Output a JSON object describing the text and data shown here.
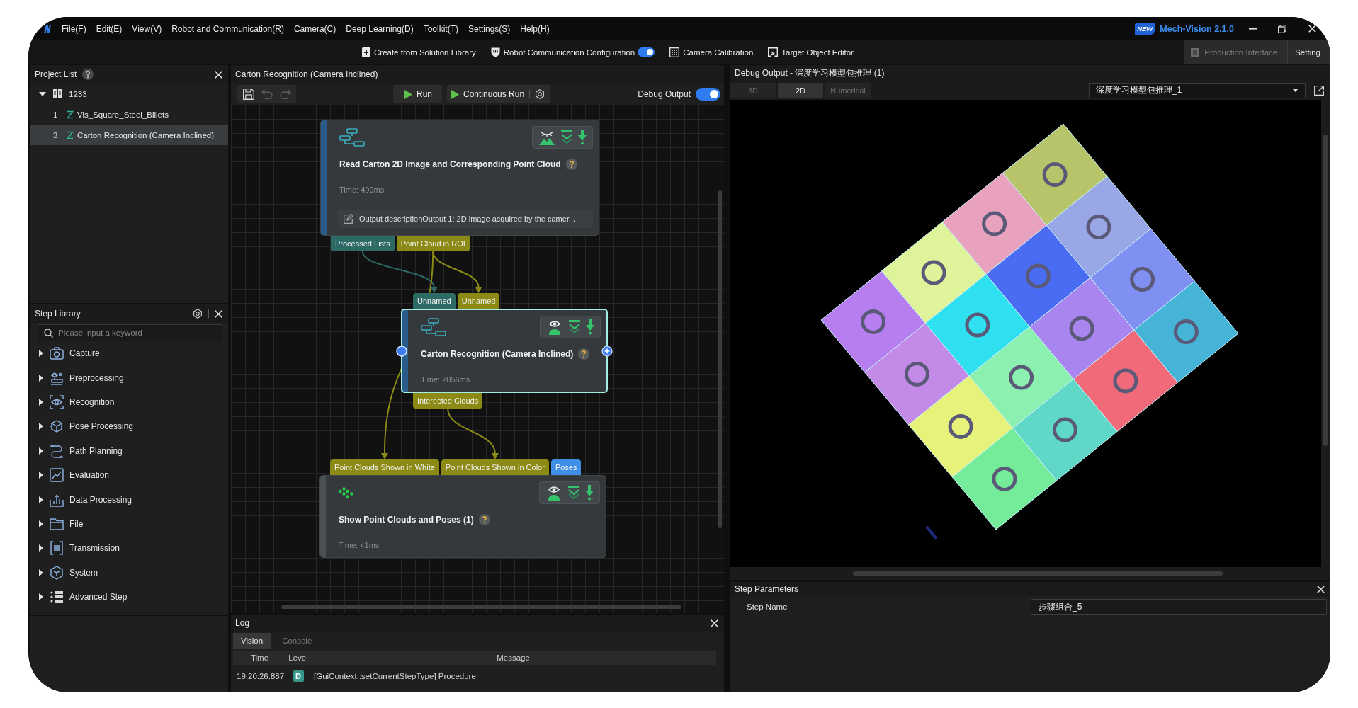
{
  "menu_bar": {
    "items": [
      "File(F)",
      "Edit(E)",
      "View(V)",
      "Robot and Communication(R)",
      "Camera(C)",
      "Deep Learning(D)",
      "Toolkit(T)",
      "Settings(S)",
      "Help(H)"
    ],
    "badge": "NEW",
    "app_title": "Mech-Vision 2.1.0"
  },
  "toolbar": {
    "items": [
      {
        "kind": "button",
        "label": "Create from Solution Library"
      },
      {
        "kind": "toggle",
        "label": "Robot Communication Configuration",
        "on": true
      },
      {
        "kind": "button",
        "label": "Camera Calibration"
      },
      {
        "kind": "button",
        "label": "Target Object Editor"
      }
    ],
    "modes": [
      {
        "label": "Production Interface",
        "disabled": true
      },
      {
        "label": "Setting",
        "disabled": false
      }
    ]
  },
  "project_list": {
    "title": "Project List",
    "projects": [
      {
        "label": "1233",
        "expanded": true,
        "children": [
          {
            "number": "1",
            "label": "Vis_Square_Steel_Billets",
            "selected": false
          },
          {
            "number": "3",
            "label": "Carton Recognition (Camera Inclined)",
            "selected": true
          }
        ]
      }
    ]
  },
  "step_library": {
    "title": "Step Library",
    "search": {
      "placeholder": "Please input a keyword"
    },
    "categories": [
      {
        "label": "Capture",
        "expanded": false
      },
      {
        "label": "Preprocessing",
        "expanded": false
      },
      {
        "label": "Recognition",
        "expanded": false
      },
      {
        "label": "Pose Processing",
        "expanded": false
      },
      {
        "label": "Path Planning",
        "expanded": false
      },
      {
        "label": "Evaluation",
        "expanded": false
      },
      {
        "label": "Data Processing",
        "expanded": false
      },
      {
        "label": "File",
        "expanded": false
      },
      {
        "label": "Transmission",
        "expanded": false
      },
      {
        "label": "System",
        "expanded": false
      },
      {
        "label": "Advanced Step",
        "expanded": false
      }
    ]
  },
  "editor": {
    "title": "Carton Recognition (Camera Inclined)",
    "history": [
      {
        "kind": "save",
        "disabled": false
      },
      {
        "kind": "undo",
        "disabled": true
      },
      {
        "kind": "redo",
        "disabled": true
      }
    ],
    "run_buttons": [
      {
        "kind": "run",
        "label": "Run"
      },
      {
        "kind": "continuous",
        "label": "Continuous Run"
      }
    ],
    "debug_output": {
      "label": "Debug Output",
      "on": true
    },
    "nodes": [
      {
        "kind": "procedure",
        "title": "Read Carton 2D Image and Corresponding Point Cloud",
        "time": "Time: 499ms",
        "description": "Output descriptionOutput 1: 2D image acquired by the camer...",
        "selected": false,
        "preview": false,
        "outputs": [
          {
            "label": "Processed Lists",
            "color": "#2d6a66"
          },
          {
            "label": "Point Cloud in ROI",
            "color": "#8a8a14"
          }
        ]
      },
      {
        "kind": "procedure",
        "title": "Carton Recognition (Camera Inclined)",
        "time": "Time: 2056ms",
        "selected": true,
        "preview": true,
        "inputs": [
          {
            "label": "Unnamed",
            "color": "#2d6a66"
          },
          {
            "label": "Unnamed",
            "color": "#8a8a14"
          }
        ],
        "outputs": [
          {
            "label": "Interected Clouds",
            "color": "#8a8a14"
          }
        ]
      },
      {
        "kind": "step",
        "title": "Show Point Clouds and Poses (1)",
        "time": "Time: <1ms",
        "selected": false,
        "preview": true,
        "inputs": [
          {
            "label": "Point Clouds Shown in White",
            "color": "#8a8a14"
          },
          {
            "label": "Point Clouds Shown in Color",
            "color": "#8a8a14"
          },
          {
            "label": "Poses",
            "color": "#3f8fe6"
          }
        ]
      }
    ]
  },
  "log": {
    "title": "Log",
    "tabs": [
      {
        "label": "Vision",
        "selected": true
      },
      {
        "label": "Console",
        "selected": false
      }
    ],
    "columns": [
      "Time",
      "Level",
      "Message"
    ],
    "rows": [
      {
        "time": "19:20:26.887",
        "level": "D",
        "color": "#36988c",
        "message": "[GuiContext::setCurrentStepType] Procedure"
      }
    ]
  },
  "debug_output": {
    "title": "Debug Output - 深度学习模型包推理 (1)",
    "tabs": [
      {
        "label": "3D",
        "selected": false
      },
      {
        "label": "2D",
        "selected": true
      },
      {
        "label": "Numerical",
        "selected": false
      }
    ],
    "source": {
      "value": "深度学习模型包推理_1"
    }
  },
  "step_parameters": {
    "title": "Step Parameters",
    "fields": [
      {
        "label": "Step Name",
        "value": "步骤组合_5"
      }
    ]
  }
}
